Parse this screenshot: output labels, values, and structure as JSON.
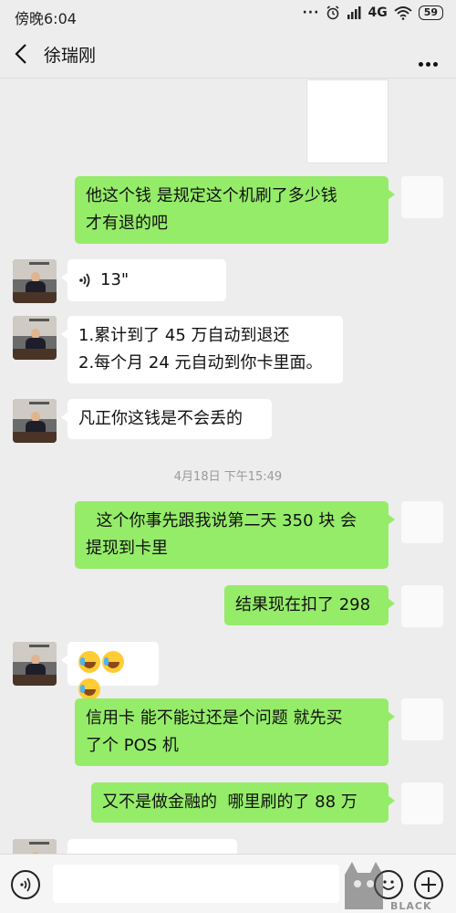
{
  "status_bar": {
    "time": "傍晚6:04",
    "network": "4G",
    "battery": "59"
  },
  "header": {
    "contact_name": "徐瑞刚"
  },
  "messages": [
    {
      "type": "image",
      "from": "self"
    },
    {
      "type": "text",
      "from": "self",
      "lines": [
        "他这个钱  是规定这个机刷了多少钱",
        "才有退的吧"
      ]
    },
    {
      "type": "voice",
      "from": "other",
      "duration": "13\""
    },
    {
      "type": "text",
      "from": "other",
      "lines": [
        "1.累计到了 45 万自动到退还",
        "2.每个月 24 元自动到你卡里面。"
      ]
    },
    {
      "type": "text",
      "from": "other",
      "lines": [
        "凡正你这钱是不会丢的"
      ]
    },
    {
      "type": "timestamp",
      "text": "4月18日 下午15:49"
    },
    {
      "type": "text",
      "from": "self",
      "lines": [
        "  这个你事先跟我说第二天 350 块 会",
        "提现到卡里"
      ]
    },
    {
      "type": "text",
      "from": "self",
      "lines": [
        "结果现在扣了 298"
      ]
    },
    {
      "type": "emoji",
      "from": "other",
      "count": 3
    },
    {
      "type": "text",
      "from": "self",
      "lines": [
        "信用卡 能不能过还是个问题 就先买",
        "了个 POS 机"
      ]
    },
    {
      "type": "text",
      "from": "self",
      "lines": [
        "又不是做金融的  哪里刷的了 88 万"
      ]
    }
  ],
  "watermark": {
    "text": "BLACK CAT"
  },
  "icons": [
    "back-arrow-icon",
    "more-icon",
    "signal-icon",
    "wifi-icon",
    "alarm-icon",
    "voice-wave-icon",
    "emoji-face-icon",
    "plus-icon"
  ]
}
